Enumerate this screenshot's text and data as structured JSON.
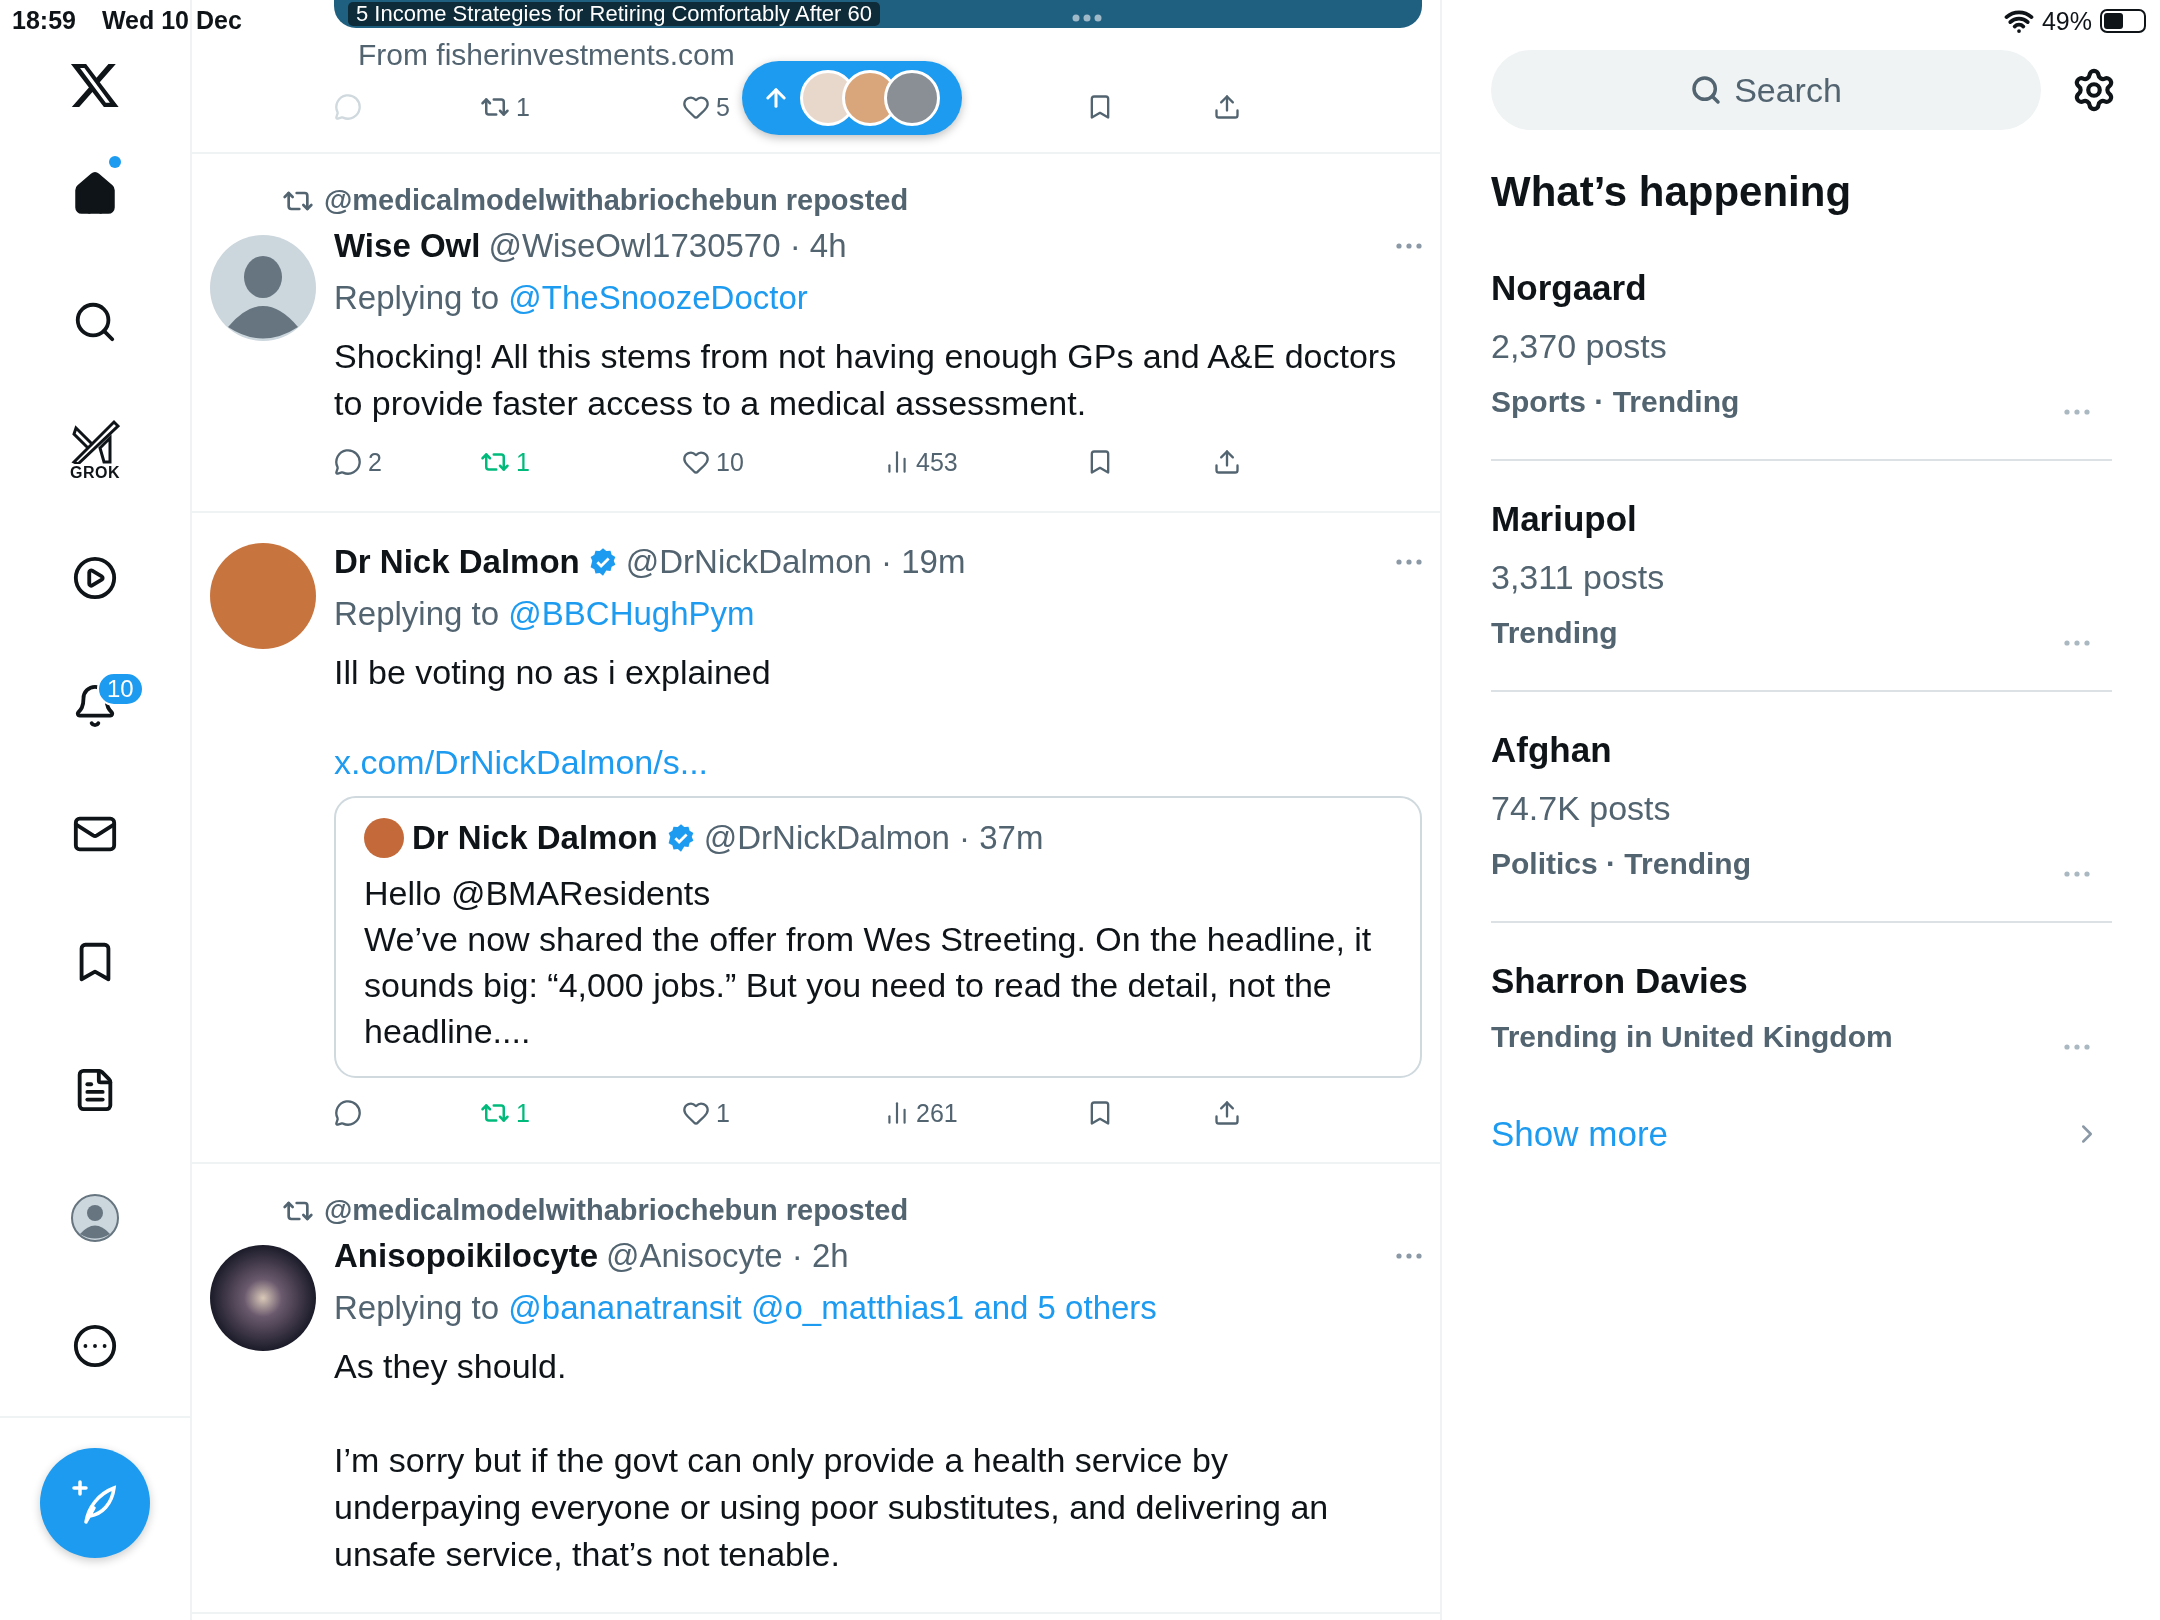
{
  "status_bar": {
    "time": "18:59",
    "date": "Wed 10 Dec",
    "battery": "49%"
  },
  "nav": {
    "items": [
      {
        "kind": "home",
        "selected": true,
        "dot": true
      },
      {
        "kind": "search",
        "selected": false
      },
      {
        "kind": "grok",
        "label": "GROK",
        "selected": false
      },
      {
        "kind": "video",
        "selected": false
      },
      {
        "kind": "notifications",
        "badge": "10",
        "selected": false
      },
      {
        "kind": "messages",
        "selected": false
      },
      {
        "kind": "bookmarks",
        "selected": false
      },
      {
        "kind": "lists",
        "selected": false
      },
      {
        "kind": "profile",
        "selected": false
      },
      {
        "kind": "more",
        "selected": false
      }
    ]
  },
  "ad_post": {
    "card_title": "5 Income Strategies for Retiring Comfortably After 60",
    "source": "From fisherinvestments.com",
    "actions": {
      "retweets": "1",
      "retweeted": false,
      "likes": "5"
    }
  },
  "posts": [
    {
      "reposted_by": "@medicalmodelwithabriochebun reposted",
      "avatar": {
        "kind": "default"
      },
      "name": "Wise Owl",
      "verified": false,
      "meta": "@WiseOwl1730570 · 4h",
      "replying_label": "Replying to",
      "replying_to": "@TheSnoozeDoctor",
      "paragraphs": [
        "Shocking! All this stems from not having enough GPs and A&E doctors to provide faster access to a medical assessment."
      ],
      "actions": {
        "replies": "2",
        "retweets": "1",
        "retweeted": true,
        "likes": "10",
        "views": "453"
      }
    },
    {
      "avatar": {
        "kind": "photo"
      },
      "name": "Dr Nick Dalmon",
      "verified": true,
      "meta": "@DrNickDalmon · 19m",
      "replying_label": "Replying to",
      "replying_to": "@BBCHughPym",
      "paragraphs": [
        "Ill be voting no as i explained"
      ],
      "link": "x.com/DrNickDalmon/s...",
      "quote": {
        "name": "Dr Nick Dalmon",
        "verified": true,
        "meta": "@DrNickDalmon · 37m",
        "lines": [
          "Hello @BMAResidents",
          "We’ve now shared the offer from Wes Streeting. On the headline, it sounds big: “4,000 jobs.” But you need to read the detail, not the headline...."
        ]
      },
      "actions": {
        "retweets": "1",
        "retweeted": true,
        "likes": "1",
        "views": "261"
      }
    },
    {
      "reposted_by": "@medicalmodelwithabriochebun reposted",
      "avatar": {
        "kind": "dark-photo"
      },
      "name": "Anisopoikilocyte",
      "verified": false,
      "meta": "@Anisocyte · 2h",
      "replying_label": "Replying to",
      "replying_to": "@bananatransit @o_matthias1 and 5 others",
      "paragraphs": [
        "As they should.",
        "I’m sorry but if the govt can only provide a health service by underpaying everyone or using poor substitutes, and delivering an unsafe service, that’s not tenable."
      ]
    }
  ],
  "search": {
    "placeholder": "Search"
  },
  "trends": {
    "title": "What’s happening",
    "items": [
      {
        "topic": "Norgaard",
        "posts": "2,370 posts",
        "context": "Sports · Trending"
      },
      {
        "topic": "Mariupol",
        "posts": "3,311 posts",
        "context": "Trending"
      },
      {
        "topic": "Afghan",
        "posts": "74.7K posts",
        "context": "Politics · Trending"
      },
      {
        "topic": "Sharron Davies",
        "context": "Trending in United Kingdom"
      }
    ],
    "show_more": "Show more"
  }
}
